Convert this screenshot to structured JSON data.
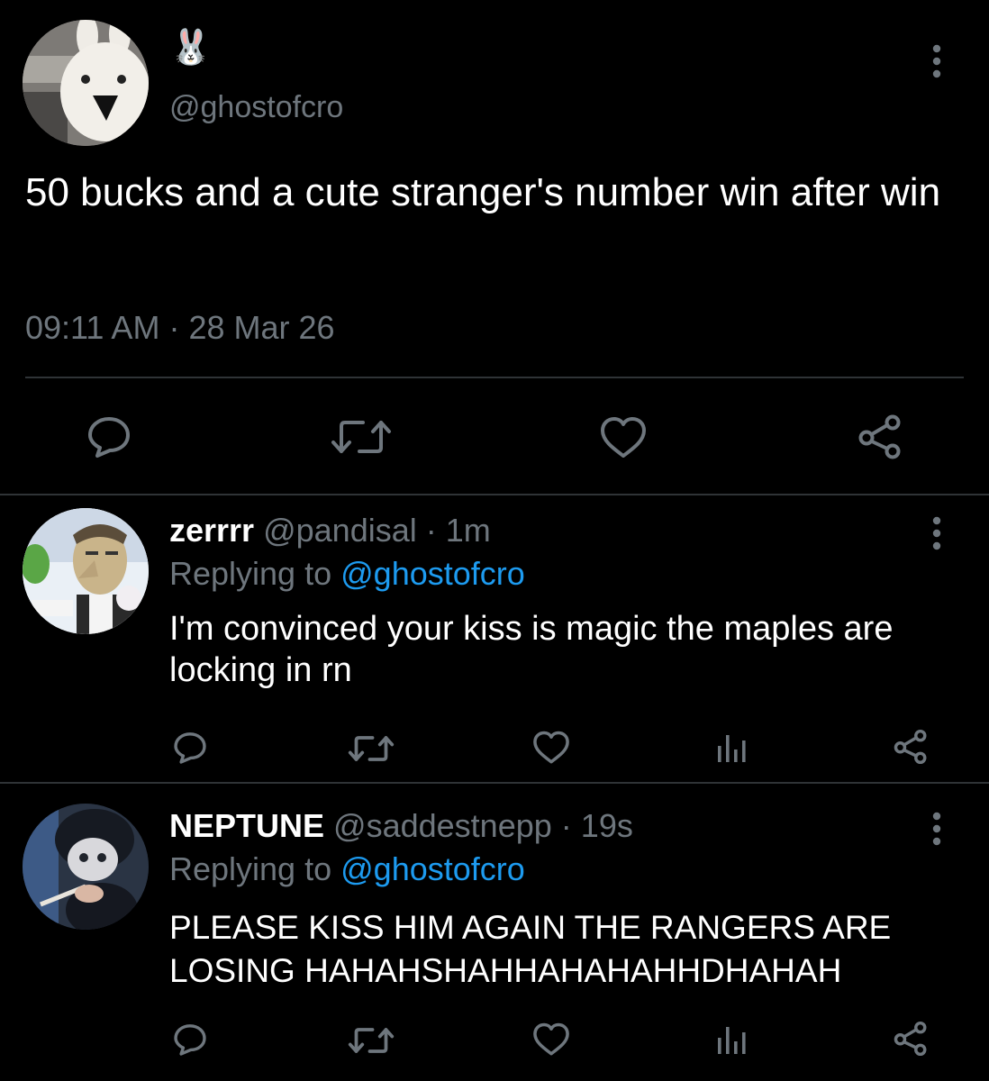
{
  "colors": {
    "background": "#000000",
    "text": "#ffffff",
    "muted": "#6e767d",
    "link": "#1d9bf0",
    "divider": "#2f3336"
  },
  "main_tweet": {
    "display_name": "🐰",
    "handle": "@ghostofcro",
    "text": "50 bucks and a cute stranger's number win after win",
    "time": "09:11 AM",
    "separator": "·",
    "date": "28 Mar 26",
    "actions": [
      "reply-icon",
      "retweet-icon",
      "like-icon",
      "share-icon"
    ]
  },
  "replies": [
    {
      "name": "zerrrr",
      "handle": "@pandisal",
      "separator": "·",
      "time": "1m",
      "replying_prefix": "Replying to",
      "replying_to": "@ghostofcro",
      "text": "I'm convinced your kiss is magic the maples are locking in rn",
      "actions": [
        "reply-icon",
        "retweet-icon",
        "like-icon",
        "analytics-icon",
        "share-icon"
      ]
    },
    {
      "name": "NEPTUNE",
      "handle": "@saddestnepp",
      "separator": "·",
      "time": "19s",
      "replying_prefix": "Replying to",
      "replying_to": "@ghostofcro",
      "text": "PLEASE KISS HIM AGAIN THE RANGERS ARE LOSING HAHAHSHAHHAHAHAHHDHAHAH",
      "actions": [
        "reply-icon",
        "retweet-icon",
        "like-icon",
        "analytics-icon",
        "share-icon"
      ]
    }
  ]
}
